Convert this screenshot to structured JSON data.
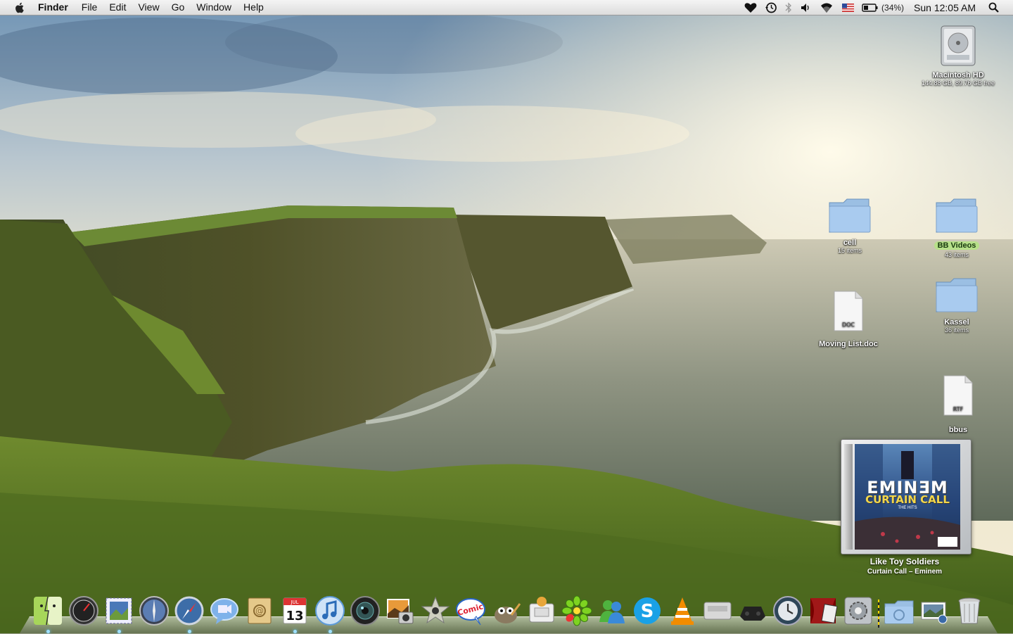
{
  "menubar": {
    "apple_icon": "apple-icon",
    "app_name": "Finder",
    "menus": [
      "File",
      "Edit",
      "View",
      "Go",
      "Window",
      "Help"
    ],
    "status": {
      "icons": [
        "heart-icon",
        "time-machine-icon",
        "bluetooth-icon",
        "volume-icon",
        "wifi-icon",
        "us-flag-icon",
        "battery-icon",
        "spotlight-icon"
      ],
      "battery_percent": "(34%)",
      "clock": "Sun 12:05 AM"
    }
  },
  "desktop": {
    "drive": {
      "name": "Macintosh HD",
      "info": "144.88 GB, 89.76 GB free"
    },
    "items": [
      {
        "name": "cell",
        "info": "15 items",
        "kind": "folder"
      },
      {
        "name": "BB Videos",
        "info": "43 items",
        "kind": "folder",
        "selected": true
      },
      {
        "name": "Moving List.doc",
        "info": "",
        "kind": "document",
        "badge": "DOC"
      },
      {
        "name": "Kassel",
        "info": "36 items",
        "kind": "folder"
      },
      {
        "name": "bbus",
        "info": "",
        "kind": "document",
        "badge": "RTF"
      }
    ]
  },
  "now_playing": {
    "artist_art": "EMINƎM",
    "album_art": "CURTAIN CALL",
    "album_art_sub": "THE HITS",
    "track": "Like Toy Soldiers",
    "album_line": "Curtain Call – Eminem"
  },
  "dock": {
    "icons": [
      "finder-icon",
      "dashboard-icon",
      "mail-icon",
      "iphoto-icon",
      "safari-icon",
      "ichat-icon",
      "address-book-icon",
      "ical-icon",
      "itunes-icon",
      "photo-booth-icon",
      "image-capture-icon",
      "imovie-icon",
      "comic-life-icon",
      "gimp-icon",
      "automator-icon",
      "icq-icon",
      "msn-messenger-icon",
      "skype-icon",
      "vlc-icon",
      "system-icon",
      "n64-icon",
      "time-machine-icon",
      "front-row-icon",
      "system-preferences-icon",
      "applications-folder-icon",
      "pictures-stack-icon",
      "trash-icon"
    ],
    "ical_month": "JUL",
    "ical_day": "13"
  },
  "colors": {
    "menubar_top": "#f4f4f4",
    "folder_blue": "#8fb8e0",
    "selection_green": "#b7e08a"
  }
}
